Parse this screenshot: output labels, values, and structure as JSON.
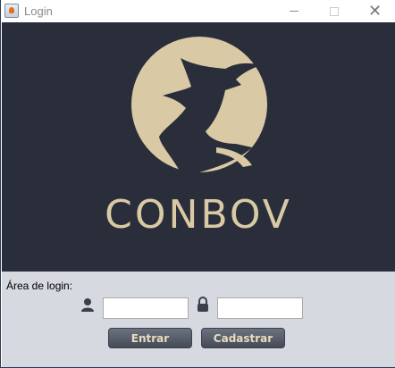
{
  "window": {
    "title": "Login",
    "icon": "java-cup-icon"
  },
  "banner": {
    "brand": "CONBOV",
    "logo": "bull-head-logo",
    "colors": {
      "background": "#2a2e3a",
      "accent": "#d9c9a5"
    }
  },
  "login": {
    "section_label": "Área de login:",
    "username": {
      "icon": "user-icon",
      "value": ""
    },
    "password": {
      "icon": "lock-icon",
      "value": ""
    },
    "enter_label": "Entrar",
    "register_label": "Cadastrar"
  }
}
